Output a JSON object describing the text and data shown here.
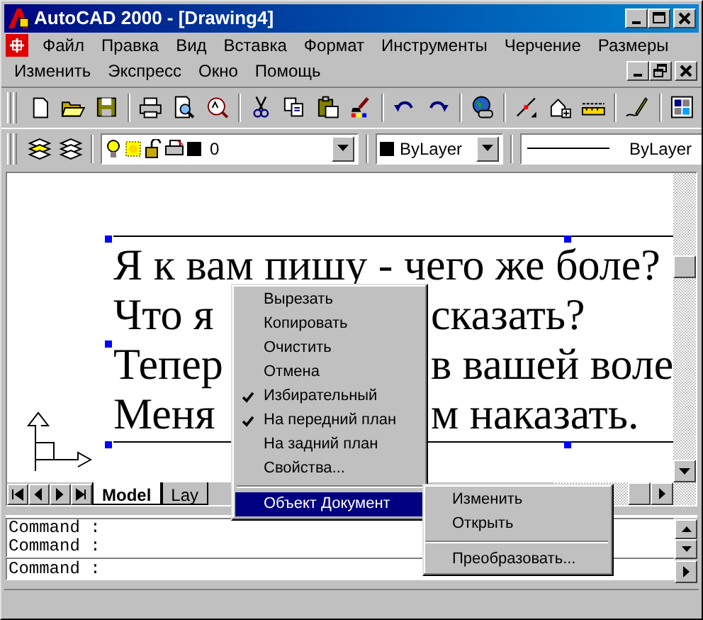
{
  "window": {
    "title": "AutoCAD 2000 - [Drawing4]"
  },
  "menu_bar": {
    "rows": [
      [
        "Файл",
        "Правка",
        "Вид",
        "Вставка",
        "Формат",
        "Инструменты",
        "Черчение",
        "Размеры"
      ],
      [
        "Изменить",
        "Экспресс",
        "Окно",
        "Помощь"
      ]
    ]
  },
  "layer_dropdown": {
    "value": "0"
  },
  "color_dropdown": {
    "value": "ByLayer"
  },
  "linetype_dropdown": {
    "value": "ByLayer"
  },
  "drawing": {
    "text_lines": [
      {
        "left": "Я к вам пишу - чего же боле?"
      },
      {
        "left": "Что я",
        "right": "сказать?"
      },
      {
        "left": "Тепер",
        "right": "в вашей воле"
      },
      {
        "left": "Меня",
        "right": "м наказать."
      }
    ]
  },
  "layout_tabs": [
    {
      "label": "Model",
      "selected": true
    },
    {
      "label": "Lay",
      "selected": false
    }
  ],
  "command_history": [
    "Command :",
    "Command :"
  ],
  "command_prompt": "Command :",
  "context_menu": {
    "items": [
      {
        "kind": "item",
        "label": "Вырезать",
        "checked": false,
        "selected": false
      },
      {
        "kind": "item",
        "label": "Копировать",
        "checked": false,
        "selected": false
      },
      {
        "kind": "item",
        "label": "Очистить",
        "checked": false,
        "selected": false
      },
      {
        "kind": "item",
        "label": "Отмена",
        "checked": false,
        "selected": false
      },
      {
        "kind": "item",
        "label": "Избирательный",
        "checked": true,
        "selected": false
      },
      {
        "kind": "item",
        "label": "На передний план",
        "checked": true,
        "selected": false
      },
      {
        "kind": "item",
        "label": "На задний план",
        "checked": false,
        "selected": false
      },
      {
        "kind": "item",
        "label": "Свойства...",
        "checked": false,
        "selected": false
      },
      {
        "kind": "separator"
      },
      {
        "kind": "submenu",
        "label": "Объект Документ",
        "checked": false,
        "selected": true
      }
    ]
  },
  "submenu": {
    "items": [
      {
        "kind": "item",
        "label": "Изменить"
      },
      {
        "kind": "item",
        "label": "Открыть"
      },
      {
        "kind": "separator"
      },
      {
        "kind": "item",
        "label": "Преобразовать..."
      }
    ]
  }
}
